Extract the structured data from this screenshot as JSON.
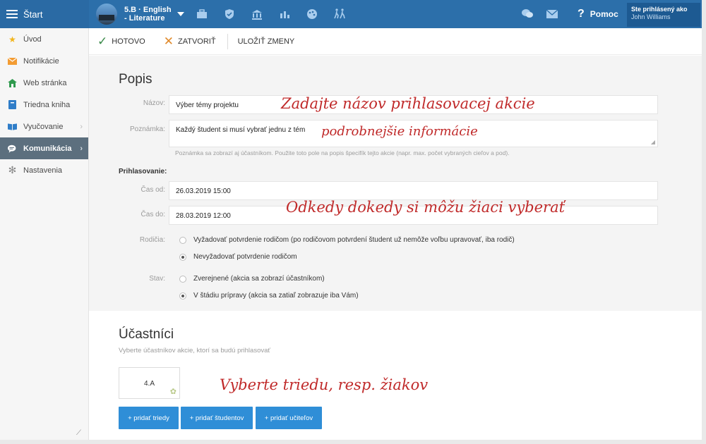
{
  "topbar": {
    "start_label": "Štart",
    "class_name_line1": "5.B · English",
    "class_name_line2": "- Literature",
    "help_label": "Pomoc",
    "user_label": "Ste prihlásený ako",
    "user_name": "John Williams",
    "icons": [
      "briefcase-icon",
      "shield-icon",
      "institution-icon",
      "bar-chart-icon",
      "palette-icon",
      "activity-icon"
    ],
    "right_icons": [
      "chat-icon",
      "mail-icon",
      "help-icon"
    ]
  },
  "sidebar": {
    "items": [
      {
        "label": "Úvod",
        "icon": "star-icon",
        "icon_color": "#f2b51b"
      },
      {
        "label": "Notifikácie",
        "icon": "envelope-icon",
        "icon_color": "#f39c33"
      },
      {
        "label": "Web stránka",
        "icon": "home-icon",
        "icon_color": "#2f9a4e"
      },
      {
        "label": "Triedna kniha",
        "icon": "book-icon",
        "icon_color": "#2f7dc8"
      },
      {
        "label": "Vyučovanie",
        "icon": "open-book-icon",
        "icon_color": "#2f7dc8"
      },
      {
        "label": "Komunikácia",
        "icon": "chat-icon",
        "icon_color": "#ffffff"
      },
      {
        "label": "Nastavenia",
        "icon": "gear-icon",
        "icon_color": "#8a8a8a"
      }
    ]
  },
  "toolbar": {
    "done_label": "HOTOVO",
    "close_label": "ZATVORIŤ",
    "save_label": "ULOŽIŤ ZMENY"
  },
  "popis": {
    "title": "Popis",
    "name_label": "Názov:",
    "name_value": "Výber témy projektu",
    "note_label": "Poznámka:",
    "note_value": "Každý študent si musí vybrať jednu z tém",
    "note_hint": "Poznámka sa zobrazí aj účastníkom. Použite toto pole na popis špecifík tejto akcie (napr. max. počet vybraných cieľov a pod).",
    "signup_label": "Prihlasovanie:",
    "from_label": "Čas od:",
    "from_value": "26.03.2019 15:00",
    "to_label": "Čas do:",
    "to_value": "28.03.2019 12:00",
    "parents_label": "Rodičia:",
    "parents_options": [
      "Vyžadovať potvrdenie rodičom (po rodičovom potvrdení študent už nemôže voľbu upravovať, iba rodič)",
      "Nevyžadovať potvrdenie rodičom"
    ],
    "parents_selected": 1,
    "state_label": "Stav:",
    "state_options": [
      "Zverejnené (akcia sa zobrazí účastníkom)",
      "V štádiu prípravy (akcia sa zatiaľ zobrazuje iba Vám)"
    ],
    "state_selected": 1
  },
  "participants": {
    "title": "Účastníci",
    "subtitle": "Vyberte účastníkov akcie, ktorí sa budú prihlasovať",
    "class_card": "4.A",
    "buttons": [
      "+ pridať triedy",
      "+ pridať študentov",
      "+ pridať učiteľov"
    ]
  },
  "annotations": {
    "name": "Zadajte názov prihlasovacej akcie",
    "details": "podrobnejšie informácie",
    "time": "Odkedy dokedy si môžu žiaci vyberať",
    "class": "Vyberte triedu, resp. žiakov"
  },
  "colors": {
    "topbar": "#2c6faa",
    "active_sidebar": "#5c6f7e",
    "button": "#2f8ed7",
    "annotation": "#c02a2a",
    "done": "#3b8a4a",
    "close": "#e08a2c"
  }
}
